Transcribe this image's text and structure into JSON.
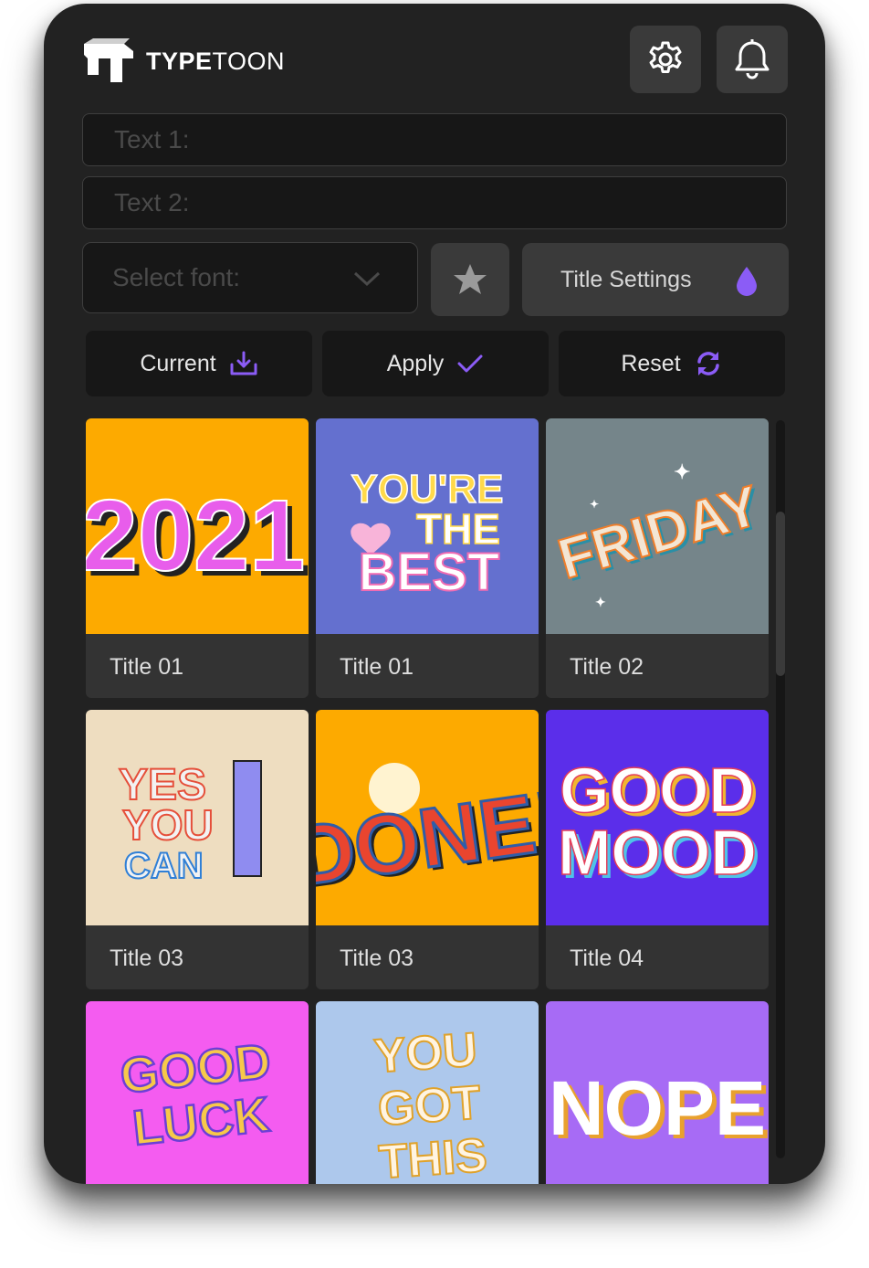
{
  "app": {
    "brand_bold": "TYPE",
    "brand_light": "TOON"
  },
  "header": {
    "settings_icon": "gear-icon",
    "notifications_icon": "bell-icon"
  },
  "inputs": {
    "text1_placeholder": "Text 1:",
    "text2_placeholder": "Text 2:"
  },
  "font_select": {
    "placeholder": "Select font:"
  },
  "buttons": {
    "favorite_icon": "star-icon",
    "title_settings": "Title Settings",
    "current": "Current",
    "apply": "Apply",
    "reset": "Reset"
  },
  "colors": {
    "accent": "#8B5CF6",
    "panel": "#222222",
    "button": "#3a3a3a"
  },
  "templates": [
    {
      "title": "Title 01",
      "art_text": [
        "2021"
      ],
      "bg": "#FDAA00"
    },
    {
      "title": "Title 01",
      "art_text": [
        "YOU'RE",
        "THE",
        "BEST"
      ],
      "bg": "#6470CF"
    },
    {
      "title": "Title 02",
      "art_text": [
        "FRIDAY"
      ],
      "bg": "#75858A"
    },
    {
      "title": "Title 03",
      "art_text": [
        "YES",
        "YOU",
        "CAN"
      ],
      "bg": "#EEDDC0"
    },
    {
      "title": "Title 03",
      "art_text": [
        "DONE!"
      ],
      "bg": "#FDAA00"
    },
    {
      "title": "Title 04",
      "art_text": [
        "GOOD",
        "MOOD"
      ],
      "bg": "#5B2EEA"
    },
    {
      "title": "",
      "art_text": [
        "GOOD",
        "LUCK"
      ],
      "bg": "#F45CF0"
    },
    {
      "title": "",
      "art_text": [
        "YOU",
        "GOT",
        "THIS"
      ],
      "bg": "#ADC8EC"
    },
    {
      "title": "",
      "art_text": [
        "NOPE"
      ],
      "bg": "#A76BF5"
    }
  ]
}
